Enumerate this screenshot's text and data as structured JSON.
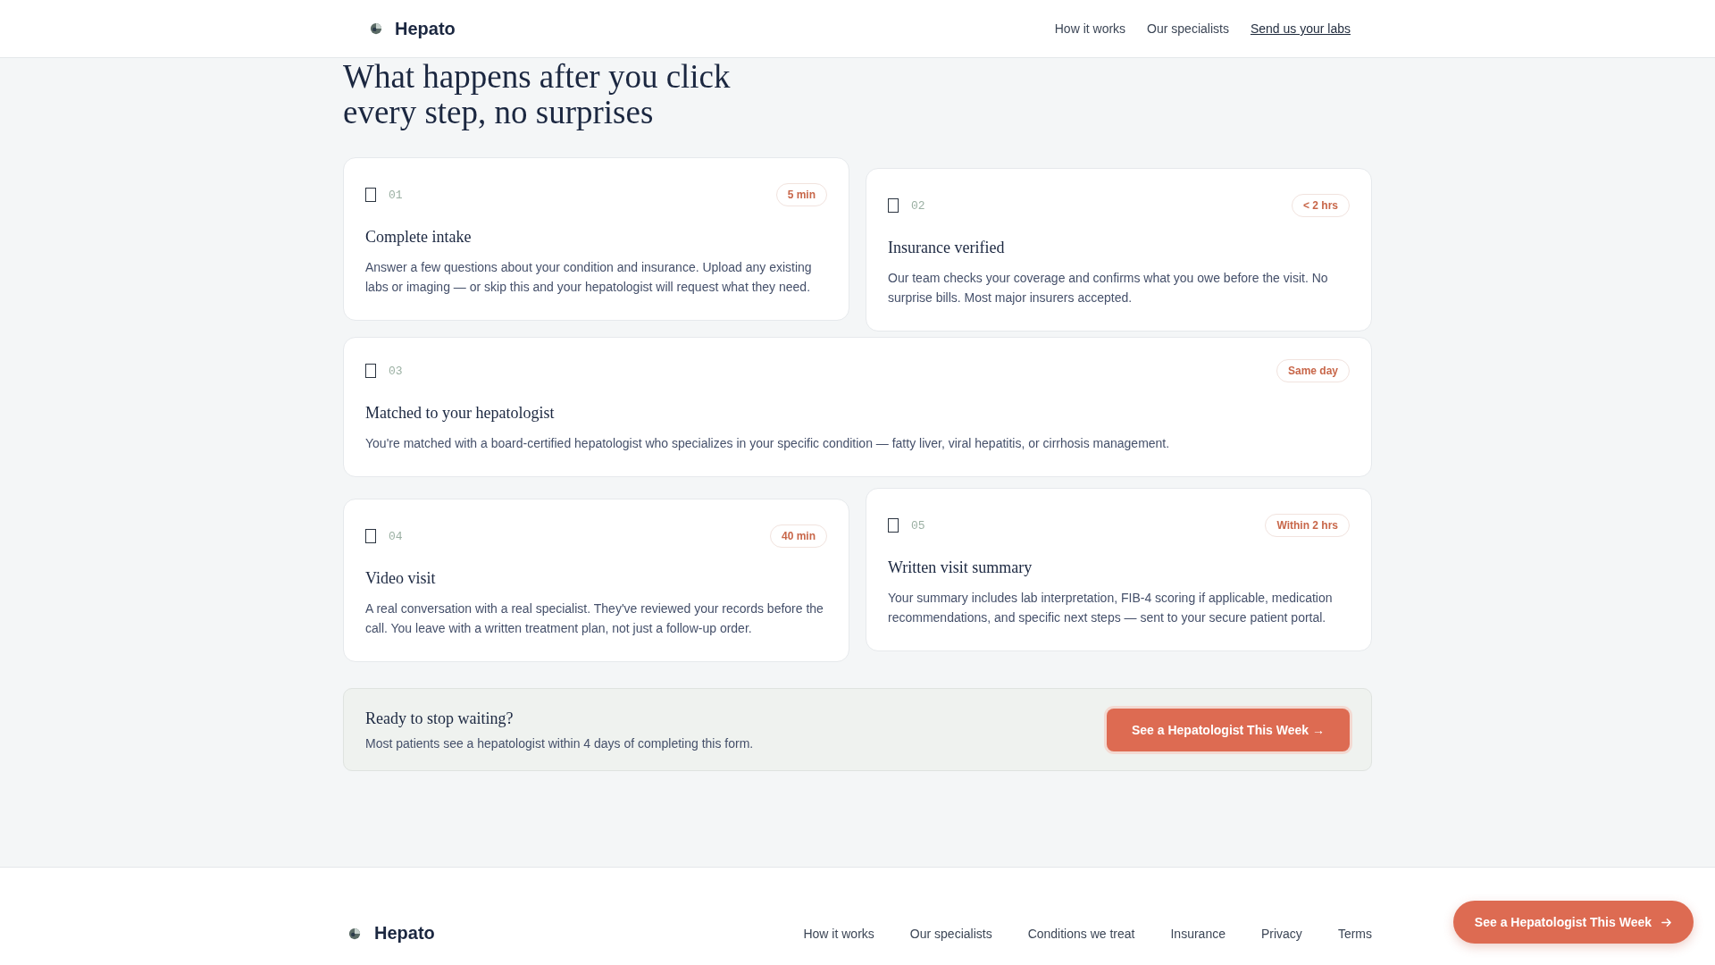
{
  "header": {
    "brand": "Hepato",
    "nav": [
      {
        "label": "How it works",
        "underlined": false
      },
      {
        "label": "Our specialists",
        "underlined": false
      },
      {
        "label": "Send us your labs",
        "underlined": true
      }
    ]
  },
  "section": {
    "heading_lines": [
      "What happens after you click",
      "every step, no surprises"
    ]
  },
  "steps": [
    {
      "kind": "half",
      "number": "01",
      "duration": "5 min",
      "title": "Complete intake",
      "text": "Answer a few questions about your condition and insurance. Upload any existing labs or imaging — or skip this and your hepatologist will request what they need."
    },
    {
      "kind": "half",
      "number": "02",
      "duration": "< 2 hrs",
      "title": "Insurance verified",
      "text": "Our team checks your coverage and confirms what you owe before the visit. No surprise bills. Most major insurers accepted."
    },
    {
      "kind": "full",
      "number": "03",
      "duration": "Same day",
      "title": "Matched to your hepatologist",
      "text": "You're matched with a board-certified hepatologist who specializes in your specific condition — fatty liver, viral hepatitis, or cirrhosis management."
    },
    {
      "kind": "half",
      "number": "04",
      "duration": "40 min",
      "title": "Video visit",
      "text": "A real conversation with a real specialist. They've reviewed your records before the call. You leave with a written treatment plan, not just a follow-up order."
    },
    {
      "kind": "half",
      "number": "05",
      "duration": "Within 2 hrs",
      "title": "Written visit summary",
      "text": "Your summary includes lab interpretation, FIB-4 scoring if applicable, medication recommendations, and specific next steps — sent to your secure patient portal."
    }
  ],
  "cta": {
    "title": "Ready to stop waiting?",
    "text": "Most patients see a hepatologist within 4 days of completing this form.",
    "button": "See a Hepatologist This Week →"
  },
  "footer": {
    "brand": "Hepato",
    "links": [
      "How it works",
      "Our specialists",
      "Conditions we treat",
      "Insurance",
      "Privacy",
      "Terms"
    ]
  },
  "floating_button": {
    "label": "See a Hepatologist This Week"
  }
}
